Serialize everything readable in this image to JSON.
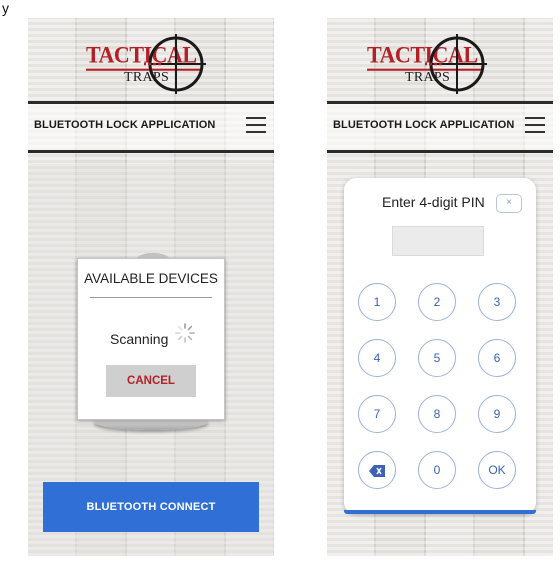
{
  "corner_mark": "y",
  "brand": {
    "word1": "TACTICAL",
    "word2": "TRAPS",
    "red": "#b32025"
  },
  "left_screen": {
    "app_title": "BLUETOOTH LOCK APPLICATION",
    "dialog": {
      "title": "AVAILABLE DEVICES",
      "scanning_text": "Scanning",
      "cancel_label": "CANCEL"
    },
    "connect_button_label": "BLUETOOTH CONNECT"
  },
  "right_screen": {
    "app_title": "BLUETOOTH LOCK APPLICATION",
    "pin_dialog": {
      "title": "Enter 4-digit PIN",
      "close_label": "×",
      "input_value": "",
      "keys": [
        "1",
        "2",
        "3",
        "4",
        "5",
        "6",
        "7",
        "8",
        "9",
        "⌫",
        "0",
        "OK"
      ]
    }
  },
  "colors": {
    "accent_blue": "#2f6fd6",
    "key_text": "#3c63b3",
    "cancel_text": "#b02226"
  },
  "icons": [
    "menu-icon",
    "spinner-icon",
    "backspace-icon",
    "crosshair-icon"
  ]
}
